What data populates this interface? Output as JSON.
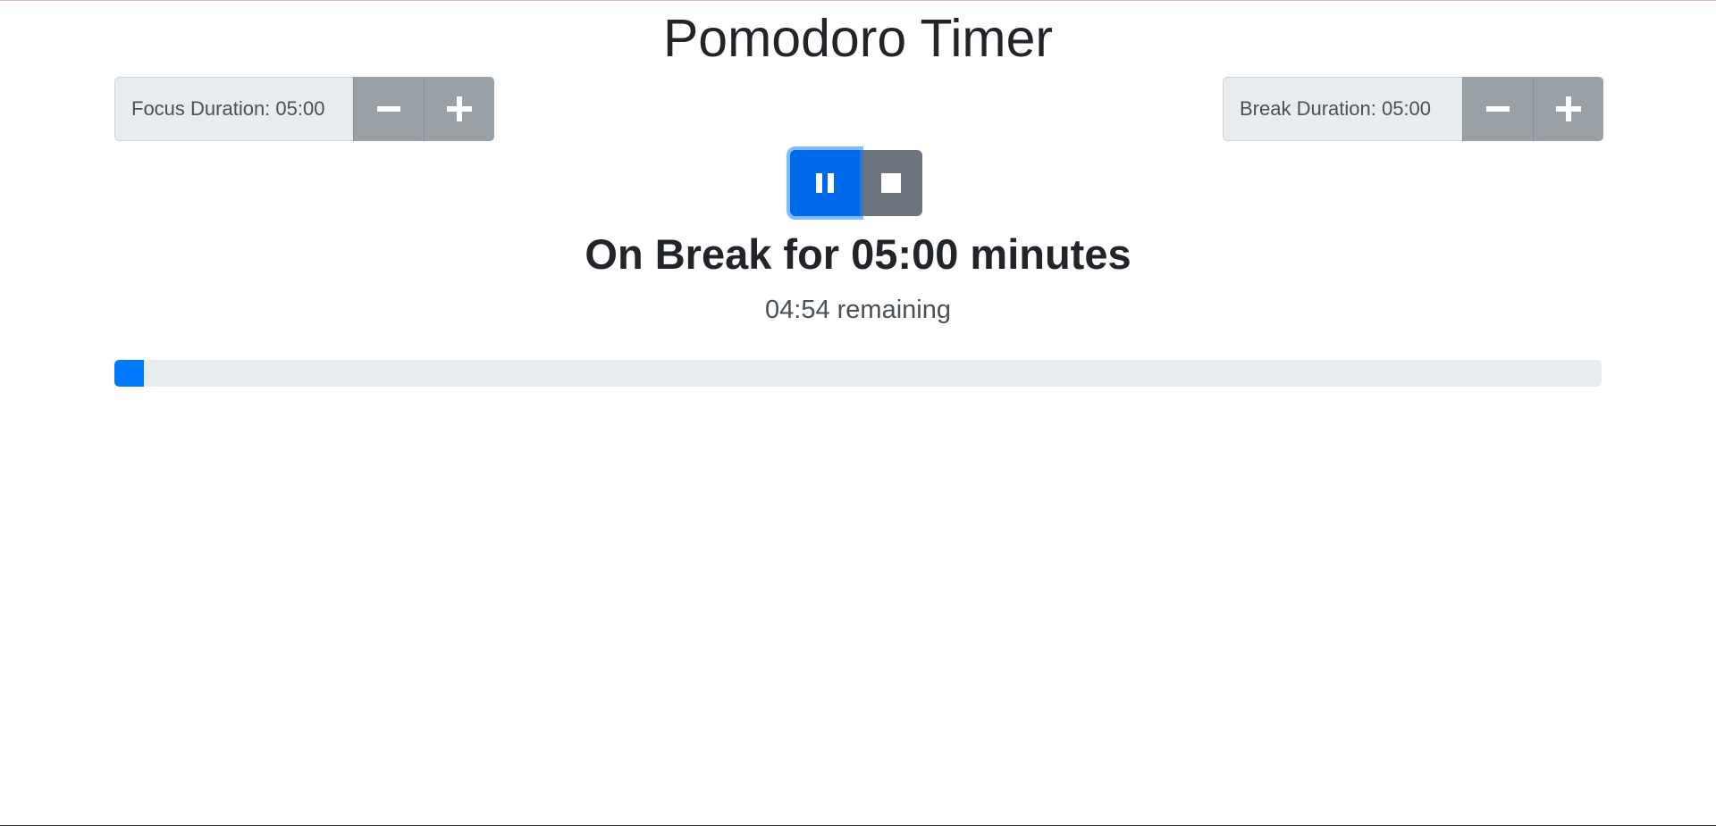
{
  "app": {
    "title": "Pomodoro Timer"
  },
  "focus": {
    "label": "Focus Duration: 05:00",
    "decrease_icon": "minus-icon",
    "increase_icon": "plus-icon"
  },
  "break": {
    "label": "Break Duration: 05:00",
    "decrease_icon": "minus-icon",
    "increase_icon": "plus-icon"
  },
  "controls": {
    "pause_icon": "pause-icon",
    "stop_icon": "stop-icon"
  },
  "status": {
    "heading": "On Break for 05:00 minutes",
    "remaining": "04:54 remaining"
  },
  "progress": {
    "fraction": 0.02,
    "color": "#007bff"
  },
  "colors": {
    "primary": "#007bff",
    "secondary": "#6c757d",
    "adjust_button": "#9aa1a6",
    "track": "#e9ecef"
  }
}
